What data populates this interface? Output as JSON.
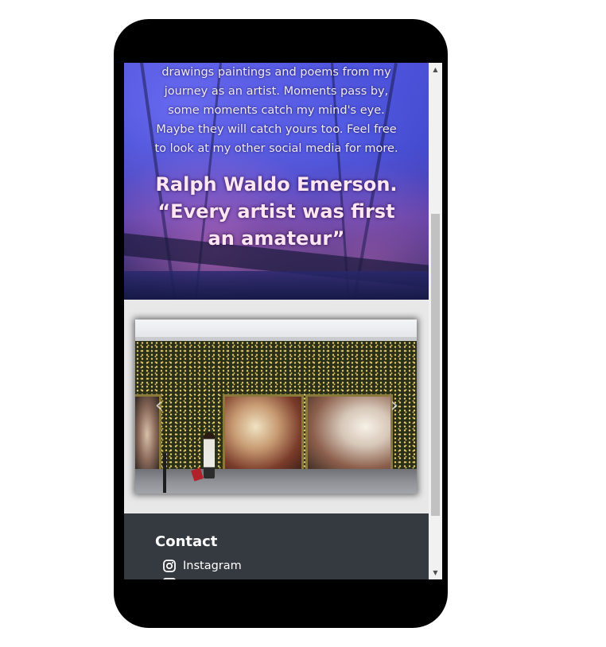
{
  "hero": {
    "intro_lines": [
      "drawings paintings and poems from my",
      "journey as an artist. Moments pass by,",
      "some moments catch my mind's eye.",
      "Maybe they will catch yours too. Feel free",
      "to look at my other social media for more."
    ],
    "quote_lines": [
      "Ralph Waldo Emerson.",
      "“Every artist was first",
      "an amateur”"
    ]
  },
  "carousel": {
    "prev_glyph": "‹",
    "next_glyph": "›",
    "prev_icon": "chevron-left-icon",
    "next_icon": "chevron-right-icon"
  },
  "footer": {
    "title": "Contact",
    "links": [
      {
        "label": "Instagram",
        "icon": "instagram-icon"
      },
      {
        "label": "",
        "icon": "facebook-icon"
      }
    ]
  },
  "scrollbar": {
    "up_glyph": "▲",
    "down_glyph": "▼"
  },
  "colors": {
    "device_frame": "#000000",
    "footer_bg": "#343a40",
    "page_bg": "#e8e8e8",
    "text_light": "#ffffff"
  }
}
